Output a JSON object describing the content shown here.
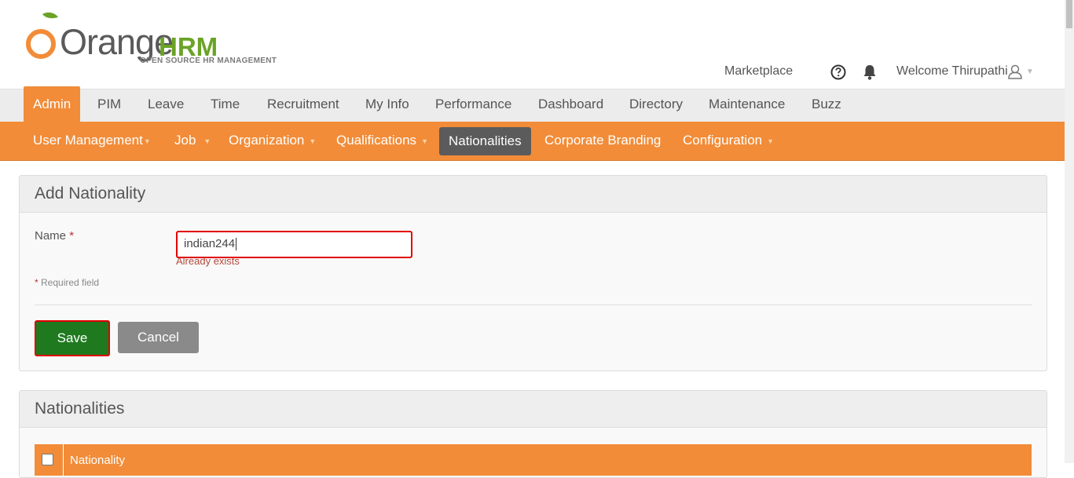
{
  "header": {
    "logo_word": "Orange",
    "logo_hrm": "HRM",
    "logo_tagline": "OPEN SOURCE HR MANAGEMENT",
    "marketplace": "Marketplace",
    "welcome": "Welcome Thirupathi"
  },
  "main_menu": {
    "items": [
      "Admin",
      "PIM",
      "Leave",
      "Time",
      "Recruitment",
      "My Info",
      "Performance",
      "Dashboard",
      "Directory",
      "Maintenance",
      "Buzz"
    ],
    "active": "Admin"
  },
  "sub_menu": {
    "items": [
      {
        "label": "User Management",
        "caret": "▼"
      },
      {
        "label": "Job",
        "caret": "▼"
      },
      {
        "label": "Organization",
        "caret": "▼"
      },
      {
        "label": "Qualifications",
        "caret": "▼"
      },
      {
        "label": "Nationalities",
        "caret": ""
      },
      {
        "label": "Corporate Branding",
        "caret": ""
      },
      {
        "label": "Configuration",
        "caret": "▼"
      }
    ],
    "active": "Nationalities"
  },
  "add_panel": {
    "title": "Add Nationality",
    "name_label": "Name",
    "required_star": "*",
    "name_value": "indian244",
    "error": "Already exists",
    "required_note": "Required field",
    "save_label": "Save",
    "cancel_label": "Cancel"
  },
  "list_panel": {
    "title": "Nationalities",
    "column": "Nationality"
  },
  "colors": {
    "brand_orange": "#f28c38",
    "save_green": "#1f7a1f",
    "error_red": "#e10000",
    "active_submenu": "#5b5b5b"
  }
}
